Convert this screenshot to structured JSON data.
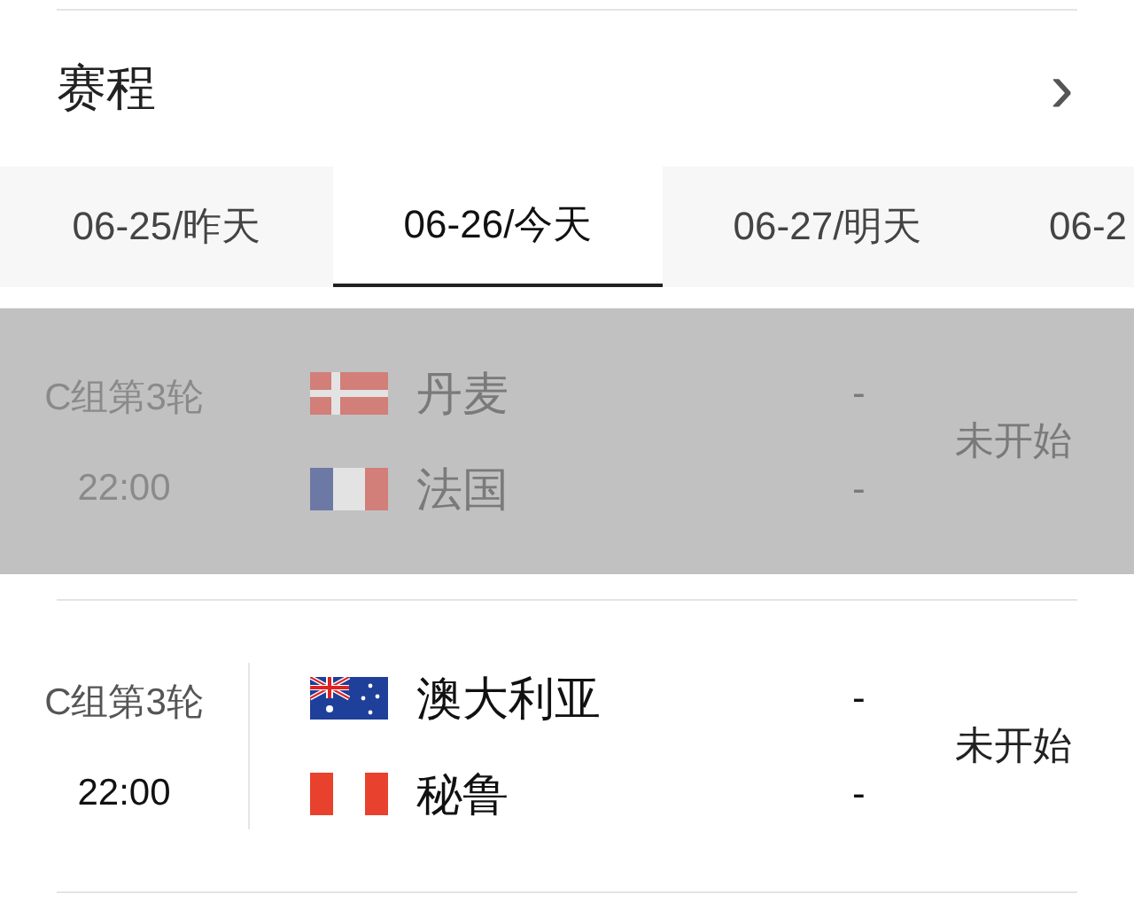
{
  "header": {
    "title": "赛程",
    "chevron": "›"
  },
  "tabs": [
    {
      "label": "06-25/昨天",
      "selected": false
    },
    {
      "label": "06-26/今天",
      "selected": true
    },
    {
      "label": "06-27/明天",
      "selected": false
    },
    {
      "label": "06-2",
      "selected": false
    }
  ],
  "matches": [
    {
      "group": "C组第3轮",
      "time": "22:00",
      "status": "未开始",
      "highlighted": true,
      "teams": [
        {
          "name": "丹麦",
          "kind": "denmark",
          "score": "-"
        },
        {
          "name": "法国",
          "kind": "france",
          "score": "-"
        }
      ]
    },
    {
      "group": "C组第3轮",
      "time": "22:00",
      "status": "未开始",
      "highlighted": false,
      "teams": [
        {
          "name": "澳大利亚",
          "kind": "australia",
          "score": "-"
        },
        {
          "name": "秘鲁",
          "kind": "peru",
          "score": "-"
        }
      ]
    }
  ]
}
